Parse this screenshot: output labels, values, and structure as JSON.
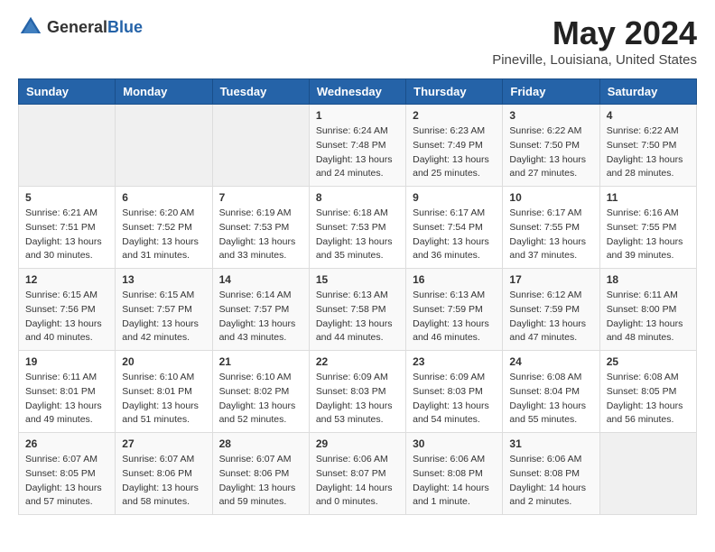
{
  "header": {
    "logo_general": "General",
    "logo_blue": "Blue",
    "title": "May 2024",
    "subtitle": "Pineville, Louisiana, United States"
  },
  "calendar": {
    "headers": [
      "Sunday",
      "Monday",
      "Tuesday",
      "Wednesday",
      "Thursday",
      "Friday",
      "Saturday"
    ],
    "weeks": [
      [
        {
          "day": "",
          "info": ""
        },
        {
          "day": "",
          "info": ""
        },
        {
          "day": "",
          "info": ""
        },
        {
          "day": "1",
          "info": "Sunrise: 6:24 AM\nSunset: 7:48 PM\nDaylight: 13 hours\nand 24 minutes."
        },
        {
          "day": "2",
          "info": "Sunrise: 6:23 AM\nSunset: 7:49 PM\nDaylight: 13 hours\nand 25 minutes."
        },
        {
          "day": "3",
          "info": "Sunrise: 6:22 AM\nSunset: 7:50 PM\nDaylight: 13 hours\nand 27 minutes."
        },
        {
          "day": "4",
          "info": "Sunrise: 6:22 AM\nSunset: 7:50 PM\nDaylight: 13 hours\nand 28 minutes."
        }
      ],
      [
        {
          "day": "5",
          "info": "Sunrise: 6:21 AM\nSunset: 7:51 PM\nDaylight: 13 hours\nand 30 minutes."
        },
        {
          "day": "6",
          "info": "Sunrise: 6:20 AM\nSunset: 7:52 PM\nDaylight: 13 hours\nand 31 minutes."
        },
        {
          "day": "7",
          "info": "Sunrise: 6:19 AM\nSunset: 7:53 PM\nDaylight: 13 hours\nand 33 minutes."
        },
        {
          "day": "8",
          "info": "Sunrise: 6:18 AM\nSunset: 7:53 PM\nDaylight: 13 hours\nand 35 minutes."
        },
        {
          "day": "9",
          "info": "Sunrise: 6:17 AM\nSunset: 7:54 PM\nDaylight: 13 hours\nand 36 minutes."
        },
        {
          "day": "10",
          "info": "Sunrise: 6:17 AM\nSunset: 7:55 PM\nDaylight: 13 hours\nand 37 minutes."
        },
        {
          "day": "11",
          "info": "Sunrise: 6:16 AM\nSunset: 7:55 PM\nDaylight: 13 hours\nand 39 minutes."
        }
      ],
      [
        {
          "day": "12",
          "info": "Sunrise: 6:15 AM\nSunset: 7:56 PM\nDaylight: 13 hours\nand 40 minutes."
        },
        {
          "day": "13",
          "info": "Sunrise: 6:15 AM\nSunset: 7:57 PM\nDaylight: 13 hours\nand 42 minutes."
        },
        {
          "day": "14",
          "info": "Sunrise: 6:14 AM\nSunset: 7:57 PM\nDaylight: 13 hours\nand 43 minutes."
        },
        {
          "day": "15",
          "info": "Sunrise: 6:13 AM\nSunset: 7:58 PM\nDaylight: 13 hours\nand 44 minutes."
        },
        {
          "day": "16",
          "info": "Sunrise: 6:13 AM\nSunset: 7:59 PM\nDaylight: 13 hours\nand 46 minutes."
        },
        {
          "day": "17",
          "info": "Sunrise: 6:12 AM\nSunset: 7:59 PM\nDaylight: 13 hours\nand 47 minutes."
        },
        {
          "day": "18",
          "info": "Sunrise: 6:11 AM\nSunset: 8:00 PM\nDaylight: 13 hours\nand 48 minutes."
        }
      ],
      [
        {
          "day": "19",
          "info": "Sunrise: 6:11 AM\nSunset: 8:01 PM\nDaylight: 13 hours\nand 49 minutes."
        },
        {
          "day": "20",
          "info": "Sunrise: 6:10 AM\nSunset: 8:01 PM\nDaylight: 13 hours\nand 51 minutes."
        },
        {
          "day": "21",
          "info": "Sunrise: 6:10 AM\nSunset: 8:02 PM\nDaylight: 13 hours\nand 52 minutes."
        },
        {
          "day": "22",
          "info": "Sunrise: 6:09 AM\nSunset: 8:03 PM\nDaylight: 13 hours\nand 53 minutes."
        },
        {
          "day": "23",
          "info": "Sunrise: 6:09 AM\nSunset: 8:03 PM\nDaylight: 13 hours\nand 54 minutes."
        },
        {
          "day": "24",
          "info": "Sunrise: 6:08 AM\nSunset: 8:04 PM\nDaylight: 13 hours\nand 55 minutes."
        },
        {
          "day": "25",
          "info": "Sunrise: 6:08 AM\nSunset: 8:05 PM\nDaylight: 13 hours\nand 56 minutes."
        }
      ],
      [
        {
          "day": "26",
          "info": "Sunrise: 6:07 AM\nSunset: 8:05 PM\nDaylight: 13 hours\nand 57 minutes."
        },
        {
          "day": "27",
          "info": "Sunrise: 6:07 AM\nSunset: 8:06 PM\nDaylight: 13 hours\nand 58 minutes."
        },
        {
          "day": "28",
          "info": "Sunrise: 6:07 AM\nSunset: 8:06 PM\nDaylight: 13 hours\nand 59 minutes."
        },
        {
          "day": "29",
          "info": "Sunrise: 6:06 AM\nSunset: 8:07 PM\nDaylight: 14 hours\nand 0 minutes."
        },
        {
          "day": "30",
          "info": "Sunrise: 6:06 AM\nSunset: 8:08 PM\nDaylight: 14 hours\nand 1 minute."
        },
        {
          "day": "31",
          "info": "Sunrise: 6:06 AM\nSunset: 8:08 PM\nDaylight: 14 hours\nand 2 minutes."
        },
        {
          "day": "",
          "info": ""
        }
      ]
    ]
  }
}
